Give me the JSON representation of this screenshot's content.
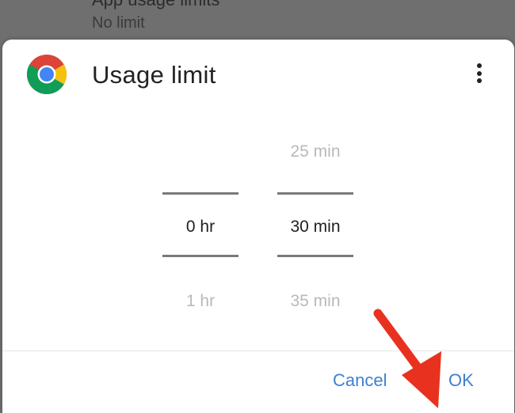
{
  "background_setting": {
    "title": "App usage limits",
    "subtitle": "No limit"
  },
  "dialog": {
    "title": "Usage limit",
    "app_icon": "chrome-icon",
    "menu_icon": "more-vert-icon"
  },
  "picker": {
    "hours": {
      "selected": "0 hr",
      "next": "1 hr"
    },
    "minutes": {
      "previous": "25 min",
      "selected": "30 min",
      "next": "35 min"
    }
  },
  "actions": {
    "cancel_label": "Cancel",
    "ok_label": "OK"
  },
  "colors": {
    "accent": "#3f7fd0",
    "annotation_arrow": "#e8321f"
  }
}
